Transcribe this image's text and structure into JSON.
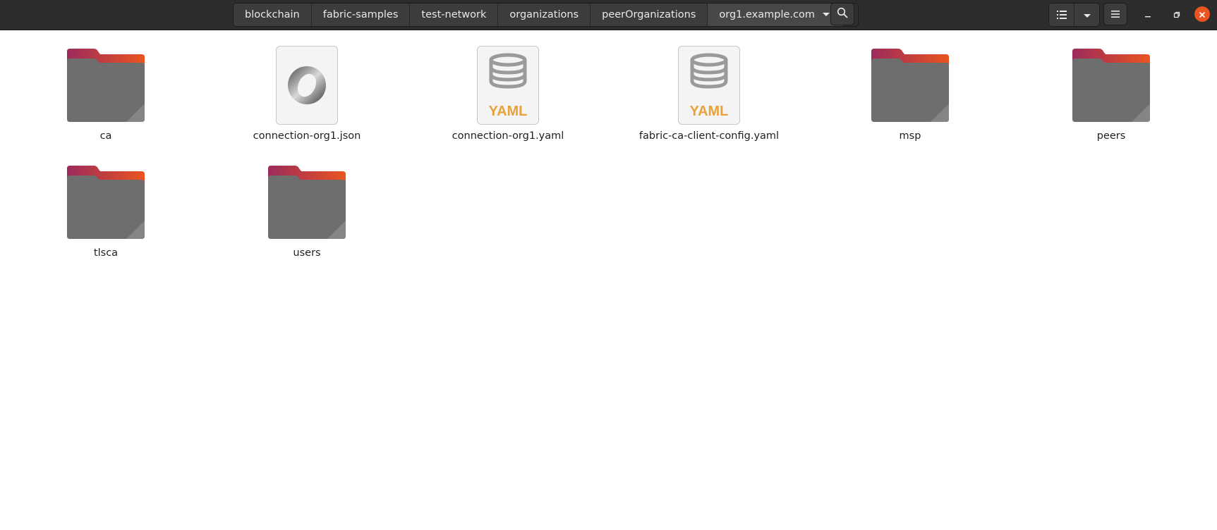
{
  "pathbar": {
    "crumbs": [
      "blockchain",
      "fabric-samples",
      "test-network",
      "organizations",
      "peerOrganizations",
      "org1.example.com"
    ]
  },
  "icons": {
    "search": "search-icon",
    "list_view": "list-view-icon",
    "view_options": "chevron-down-icon",
    "menu": "hamburger-menu-icon",
    "minimize": "minimize-icon",
    "maximize": "restore-icon",
    "close": "close-icon"
  },
  "colors": {
    "accent": "#e95420",
    "folder_body": "#6e6e6e",
    "folder_tab_start": "#9c2a5c",
    "folder_tab_end": "#e95420",
    "yaml_text": "#e9a23b"
  },
  "files": [
    {
      "name": "ca",
      "type": "folder"
    },
    {
      "name": "connection-org1.json",
      "type": "json"
    },
    {
      "name": "connection-org1.yaml",
      "type": "yaml"
    },
    {
      "name": "fabric-ca-client-config.yaml",
      "type": "yaml"
    },
    {
      "name": "msp",
      "type": "folder"
    },
    {
      "name": "peers",
      "type": "folder"
    },
    {
      "name": "tlsca",
      "type": "folder"
    },
    {
      "name": "users",
      "type": "folder"
    }
  ],
  "yaml_badge": "YAML"
}
